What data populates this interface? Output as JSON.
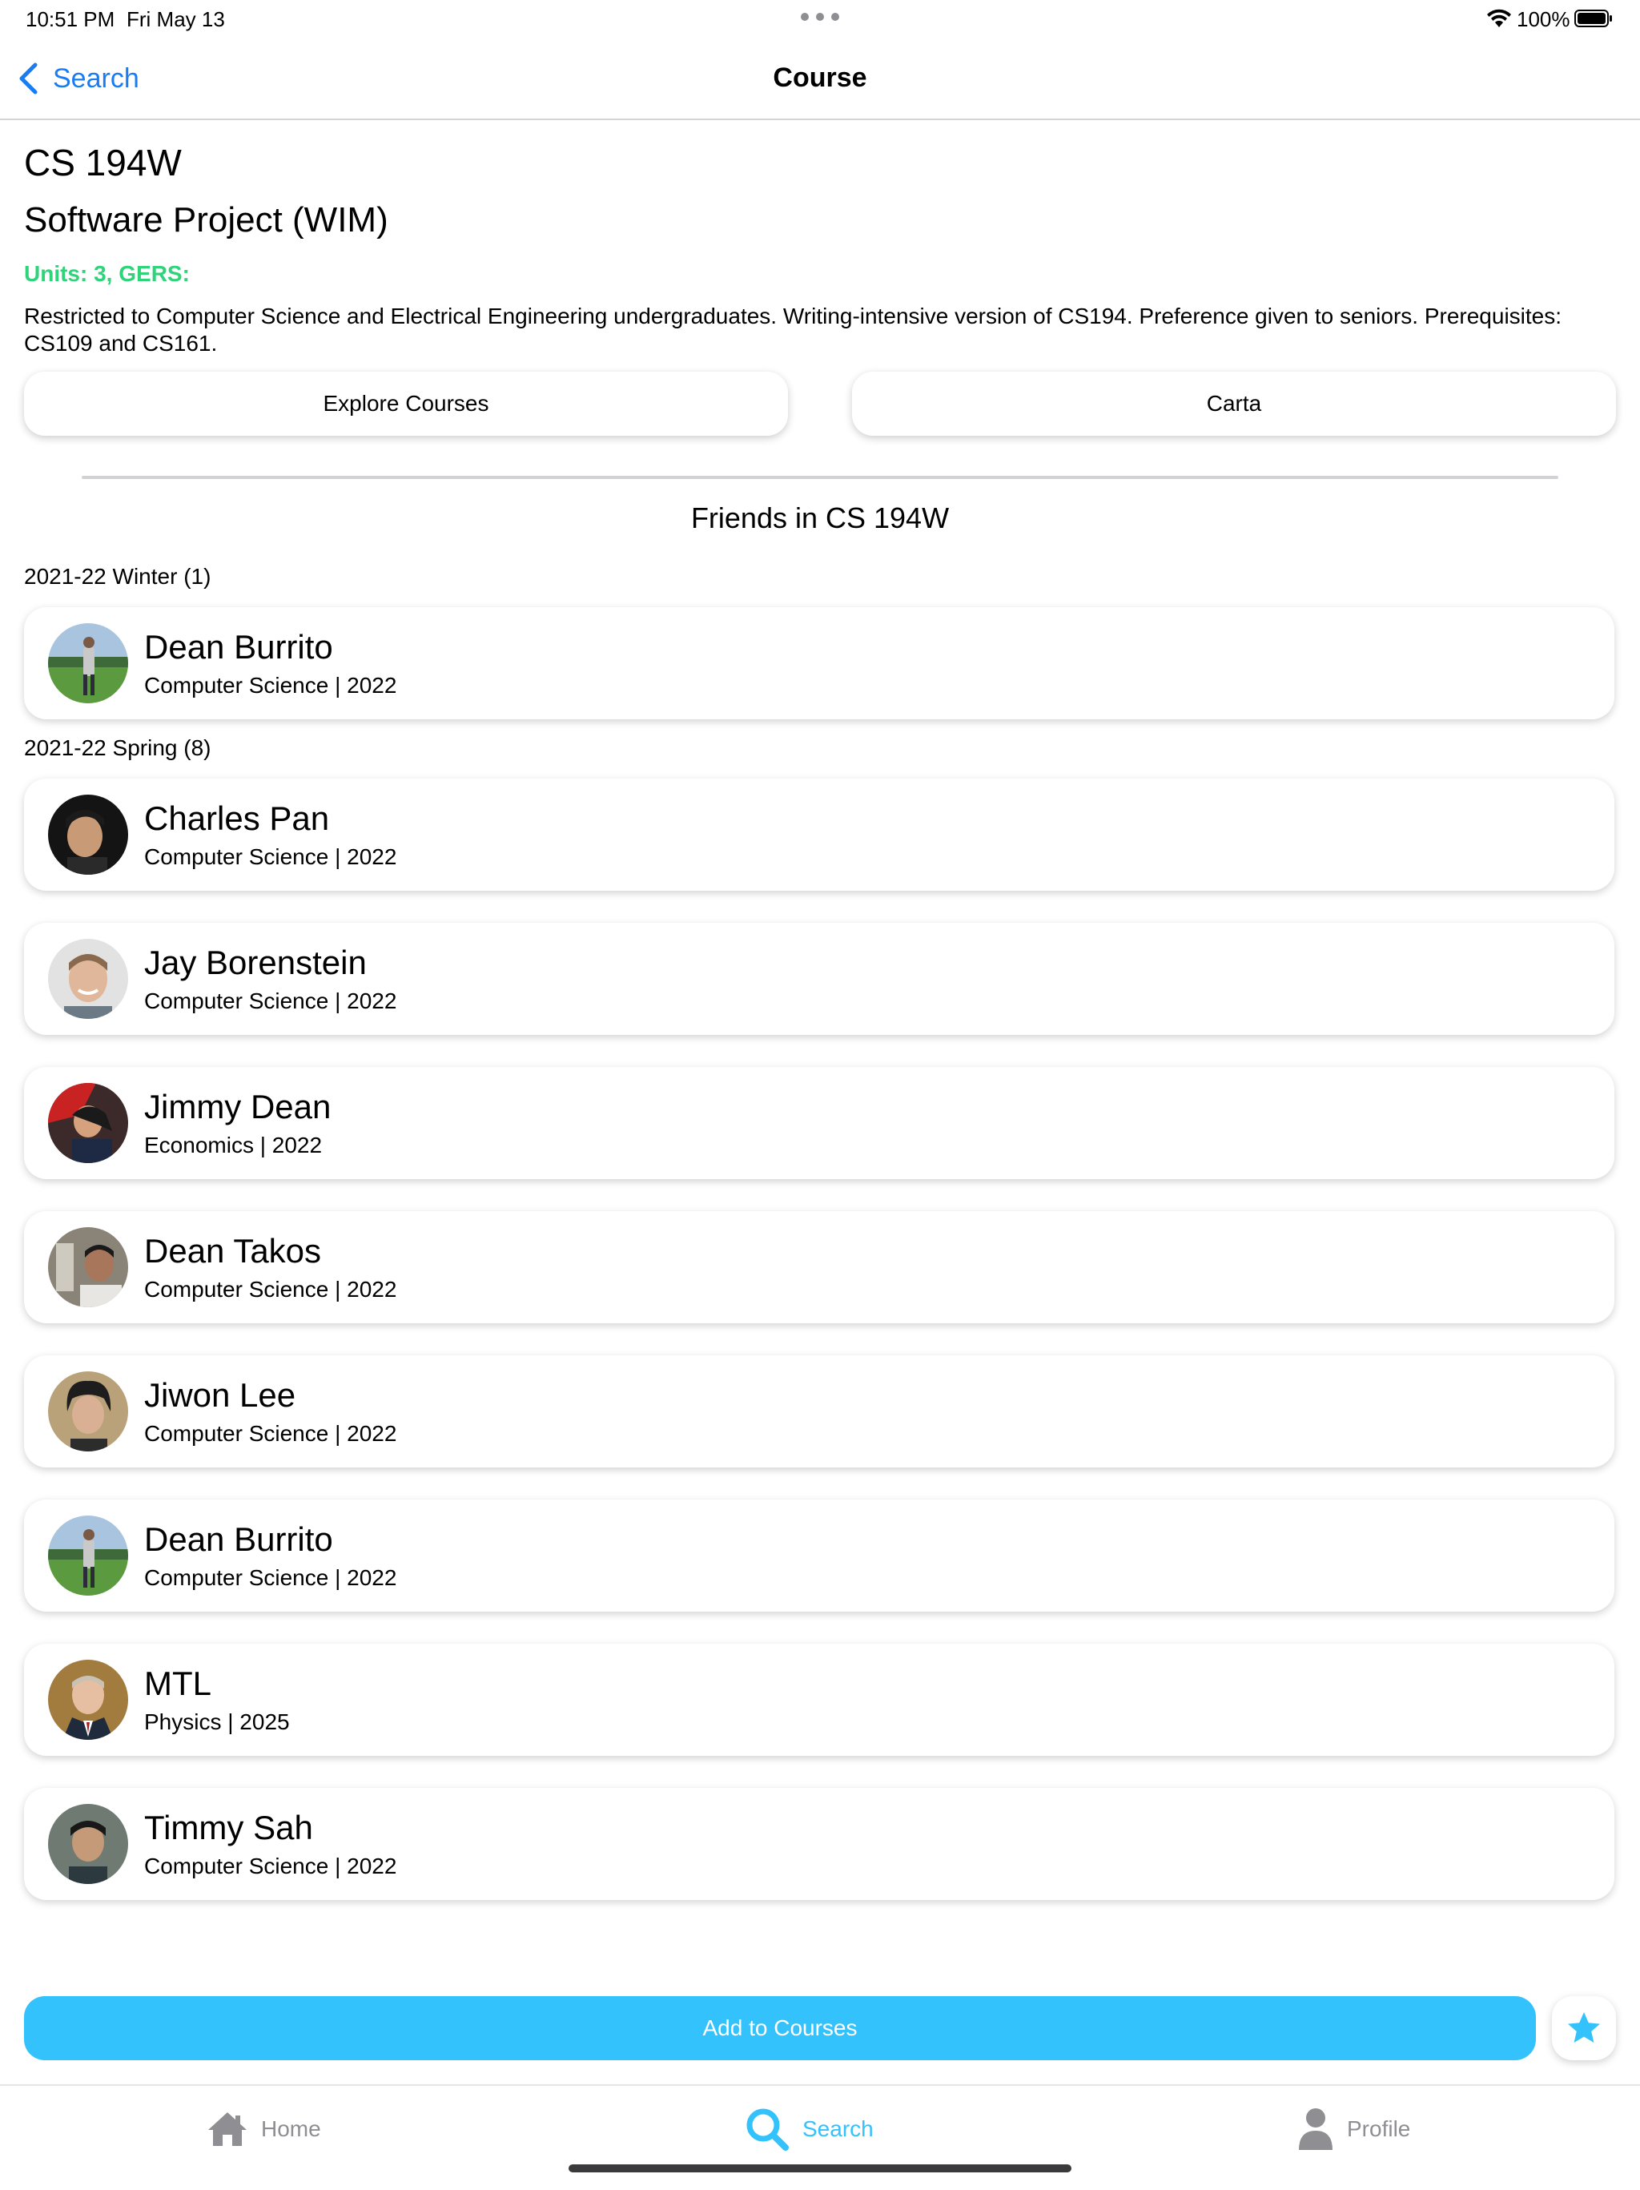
{
  "status_bar": {
    "time": "10:51 PM",
    "date": "Fri May 13",
    "battery": "100%"
  },
  "nav": {
    "back_label": "Search",
    "title": "Course"
  },
  "course": {
    "code": "CS 194W",
    "name": "Software Project (WIM)",
    "units": "Units: 3, GERS:",
    "description": "Restricted to Computer Science and Electrical Engineering undergraduates.  Writing-intensive version of CS194. Preference given to seniors. Prerequisites: CS109 and CS161."
  },
  "links": {
    "explore": "Explore Courses",
    "carta": "Carta"
  },
  "friends": {
    "heading": "Friends in CS 194W",
    "sections": [
      {
        "label": "2021-22 Winter (1)",
        "people": [
          {
            "name": "Dean Burrito",
            "detail": "Computer Science | 2022"
          }
        ]
      },
      {
        "label": "2021-22 Spring (8)",
        "people": [
          {
            "name": "Charles Pan",
            "detail": "Computer Science | 2022"
          },
          {
            "name": "Jay Borenstein",
            "detail": "Computer Science | 2022"
          },
          {
            "name": "Jimmy Dean",
            "detail": "Economics | 2022"
          },
          {
            "name": "Dean Takos",
            "detail": "Computer Science | 2022"
          },
          {
            "name": "Jiwon Lee",
            "detail": "Computer Science | 2022"
          },
          {
            "name": "Dean Burrito",
            "detail": "Computer Science | 2022"
          },
          {
            "name": "MTL",
            "detail": "Physics | 2025"
          },
          {
            "name": "Timmy Sah",
            "detail": "Computer Science | 2022"
          }
        ]
      }
    ]
  },
  "actions": {
    "add_label": "Add to Courses",
    "star_icon": "star-icon"
  },
  "tab_bar": {
    "home": "Home",
    "search": "Search",
    "profile": "Profile"
  },
  "colors": {
    "accent_blue": "#1a7cf2",
    "units_green": "#2ed37a",
    "add_button": "#33c2fb"
  }
}
